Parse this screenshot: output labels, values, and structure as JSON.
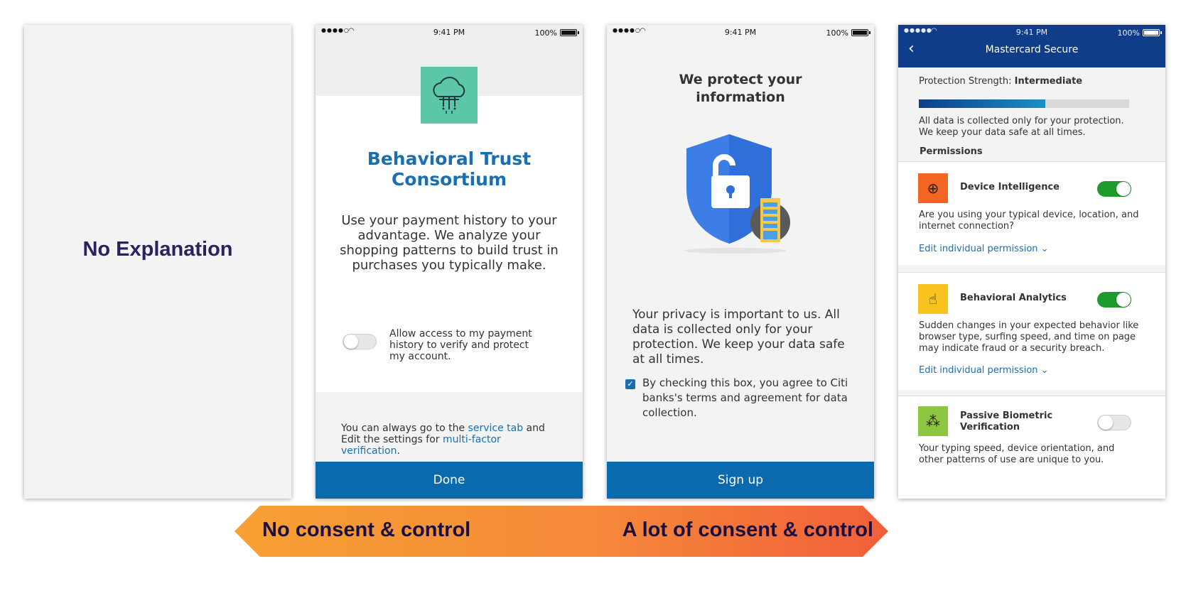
{
  "screen1": {
    "label": "No Explanation"
  },
  "status": {
    "time": "9:41 PM",
    "battery": "100%"
  },
  "screen2": {
    "title": "Behavioral Trust Consortium",
    "description": "Use your payment history to your advantage. We analyze your shopping patterns to build trust in purchases you typically make.",
    "toggle_label": "Allow access to my payment history to verify and protect my account.",
    "toggle_on": false,
    "footnote_prefix": "You can always go to the ",
    "footnote_link1": "service tab",
    "footnote_mid": " and Edit the settings for ",
    "footnote_link2": "multi-factor verification",
    "footnote_suffix": ".",
    "button": "Done",
    "logo_icon": "cloud-data-icon",
    "logo_color": "#5cc6a8"
  },
  "screen3": {
    "title": "We protect your information",
    "body": "Your privacy is important to us. All data is collected only for your protection. We keep your data safe at all times.",
    "agree": "By checking this box, you agree to Citi banks's terms and agreement for data collection.",
    "checked": true,
    "button": "Sign up"
  },
  "screen4": {
    "header_title": "Mastercard Secure",
    "strength_label": "Protection Strength: ",
    "strength_value": "Intermediate",
    "strength_level": 0.6,
    "info": "All data is collected only for your protection. We keep your data safe at all times.",
    "permissions_title": "Permissions",
    "permissions": [
      {
        "title": "Device Intelligence",
        "icon": "globe-location-icon",
        "color": "#f26522",
        "on": true,
        "desc": "Are you using your typical device, location, and internet connection?",
        "edit": "Edit individual permission"
      },
      {
        "title": "Behavioral Analytics",
        "icon": "touch-phone-icon",
        "color": "#f9c31f",
        "on": true,
        "desc": "Sudden changes in your expected behavior like browser type, surfing speed, and time on page may indicate fraud or a security breach.",
        "edit": "Edit individual permission"
      },
      {
        "title": "Passive Biometric Verification",
        "icon": "biometric-pattern-icon",
        "color": "#8dc63f",
        "on": false,
        "desc": "Your typing speed, device orientation, and other patterns of use are unique to you."
      }
    ]
  },
  "arrow": {
    "left": "No consent & control",
    "right": "A lot of consent & control"
  },
  "colors": {
    "primary_button": "#0a6aad",
    "header": "#0f3d8a",
    "toggle_on": "#1e9a2e"
  }
}
